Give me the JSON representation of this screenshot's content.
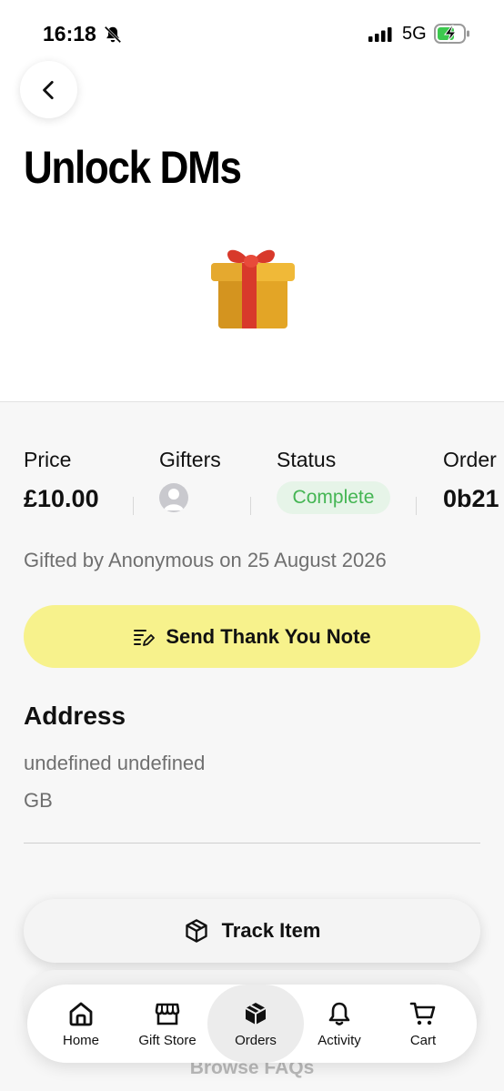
{
  "status_bar": {
    "time": "16:18",
    "network": "5G"
  },
  "page": {
    "title": "Unlock DMs",
    "gift_emoji": "🎁"
  },
  "stats": {
    "price_label": "Price",
    "price_value": "£10.00",
    "gifters_label": "Gifters",
    "status_label": "Status",
    "status_value": "Complete",
    "order_label": "Order",
    "order_value": "0b21"
  },
  "gifted_by": "Gifted by Anonymous on 25 August 2026",
  "thank_you_button": "Send Thank You Note",
  "address": {
    "heading": "Address",
    "line1": "undefined undefined",
    "line2": "GB"
  },
  "track_button": "Track Item",
  "faq_link": "Browse FAQs",
  "tabs": [
    {
      "label": "Home",
      "icon": "home-icon"
    },
    {
      "label": "Gift Store",
      "icon": "store-icon"
    },
    {
      "label": "Orders",
      "icon": "package-icon",
      "active": true
    },
    {
      "label": "Activity",
      "icon": "bell-icon"
    },
    {
      "label": "Cart",
      "icon": "cart-icon"
    }
  ],
  "colors": {
    "thank_button_bg": "#f7f28c",
    "status_badge_bg": "#e6f4e8",
    "status_badge_text": "#44b553"
  }
}
